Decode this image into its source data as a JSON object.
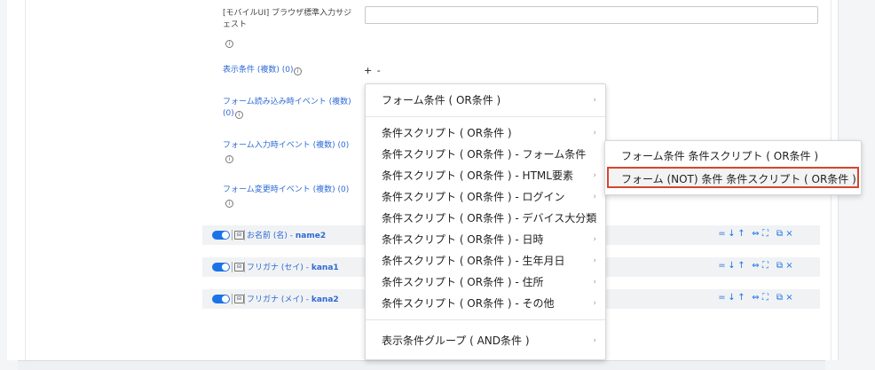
{
  "form": {
    "suggest_label_line1": "[モバイルUI] ブラウザ標準入力サジ",
    "suggest_label_line2": "ェスト",
    "display_condition_label": "表示条件 (複数) (0)",
    "plus_minus": "+ -",
    "load_event_label_line1": "フォーム読み込み時イベント (複数)",
    "load_event_label_line2": "(0)",
    "input_event_label": "フォーム入力時イベント (複数) (0)",
    "change_event_label": "フォーム変更時イベント (複数) (0)",
    "info_glyph": "i"
  },
  "rows": [
    {
      "label": "お名前 (名) - ",
      "field": "name2"
    },
    {
      "label": "フリガナ (セイ) - ",
      "field": "kana1"
    },
    {
      "label": "フリガナ (メイ) - ",
      "field": "kana2"
    }
  ],
  "row_actions": [
    "=",
    "↓",
    "↑",
    "⇔",
    "⛶",
    "⧉",
    "×"
  ],
  "menu": {
    "items": [
      "フォーム条件 ( OR条件 )",
      "条件スクリプト ( OR条件 )",
      "条件スクリプト ( OR条件 ) - フォーム条件",
      "条件スクリプト ( OR条件 ) - HTML要素",
      "条件スクリプト ( OR条件 ) - ログイン",
      "条件スクリプト ( OR条件 ) - デバイス大分類",
      "条件スクリプト ( OR条件 ) - 日時",
      "条件スクリプト ( OR条件 ) - 生年月日",
      "条件スクリプト ( OR条件 ) - 住所",
      "条件スクリプト ( OR条件 ) - その他",
      "表示条件グループ ( AND条件 )"
    ],
    "arrow": "›"
  },
  "submenu": {
    "items": [
      "フォーム条件 条件スクリプト ( OR条件 )",
      "フォーム (NOT) 条件 条件スクリプト ( OR条件 )"
    ]
  },
  "colors": {
    "accent": "#1a73e8",
    "link": "#2d6ad6",
    "highlight_border": "#d9442e"
  }
}
